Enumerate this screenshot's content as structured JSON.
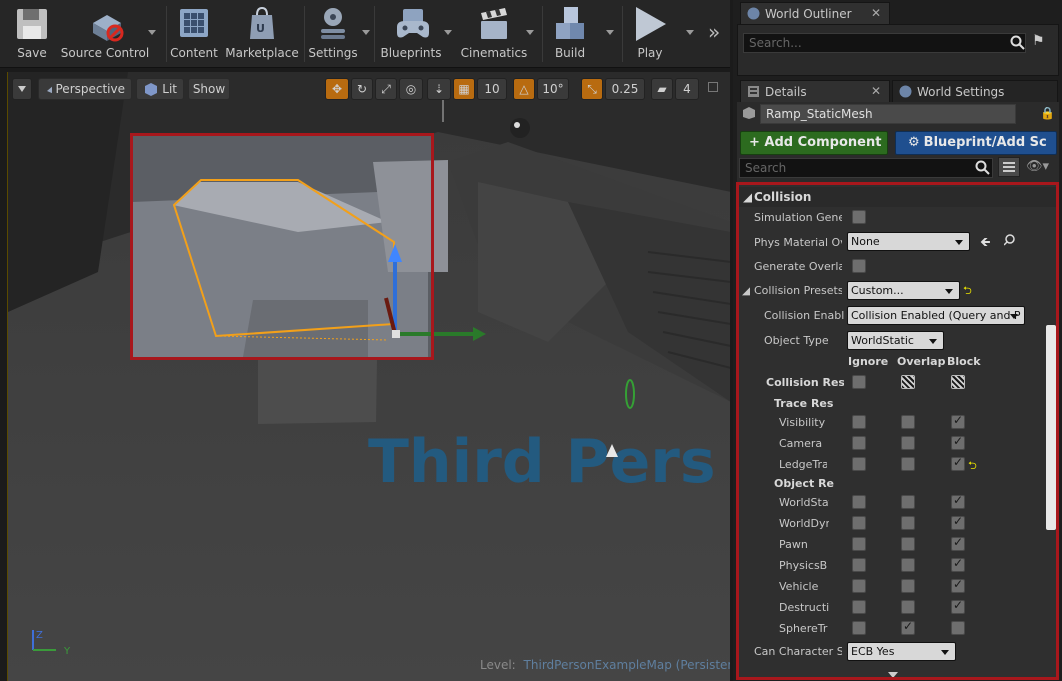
{
  "toolbar": {
    "buttons": [
      {
        "label": "Save",
        "icon": "floppy-disk-icon"
      },
      {
        "label": "Source Control",
        "icon": "source-control-icon"
      },
      {
        "label": "Content",
        "icon": "content-grid-icon"
      },
      {
        "label": "Marketplace",
        "icon": "marketplace-bag-icon"
      },
      {
        "label": "Settings",
        "icon": "gear-stack-icon"
      },
      {
        "label": "Blueprints",
        "icon": "gamepad-icon"
      },
      {
        "label": "Cinematics",
        "icon": "clapperboard-icon"
      },
      {
        "label": "Build",
        "icon": "build-blocks-icon"
      },
      {
        "label": "Play",
        "icon": "play-triangle-icon"
      }
    ],
    "overflow": "»"
  },
  "viewport": {
    "perspective_label": "Perspective",
    "lit_label": "Lit",
    "show_label": "Show",
    "grid_snap": "10",
    "rotation_snap": "10°",
    "scale_snap": "0.25",
    "camera_speed": "4",
    "level_prefix": "Level:",
    "level_name": "ThirdPersonExampleMap (Persistent)",
    "floor_text": "Third Pers",
    "axis_z": "Z",
    "axis_y": "Y"
  },
  "outliner": {
    "tab_label": "World Outliner",
    "search_placeholder": "Search..."
  },
  "details": {
    "tab_label": "Details",
    "world_settings_label": "World Settings",
    "object_name": "Ramp_StaticMesh",
    "add_component_label": "+ Add Component",
    "blueprint_label": "Blueprint/Add Sc",
    "search_placeholder": "Search",
    "section_title": "Collision",
    "simulation_generates_label": "Simulation Genera",
    "phys_material_label": "Phys Material Ov",
    "phys_material_value": "None",
    "generate_overlap_label": "Generate Overlap",
    "collision_presets_label": "Collision Presets",
    "collision_presets_value": "Custom...",
    "collision_enabled_label": "Collision Enable",
    "collision_enabled_value": "Collision Enabled (Query and P",
    "object_type_label": "Object Type",
    "object_type_value": "WorldStatic",
    "col_ignore": "Ignore",
    "col_overlap": "Overlap",
    "col_block": "Block",
    "collision_responses_label": "Collision Respo",
    "trace_responses_label": "Trace Resp",
    "object_responses_label": "Object Resp",
    "trace_rows": [
      {
        "label": "Visibility",
        "ignore": false,
        "overlap": false,
        "block": true
      },
      {
        "label": "Camera",
        "ignore": false,
        "overlap": false,
        "block": true
      },
      {
        "label": "LedgeTra",
        "ignore": false,
        "overlap": false,
        "block": true,
        "reset": true
      }
    ],
    "object_rows": [
      {
        "label": "WorldStat",
        "ignore": false,
        "overlap": false,
        "block": true
      },
      {
        "label": "WorldDyn",
        "ignore": false,
        "overlap": false,
        "block": true
      },
      {
        "label": "Pawn",
        "ignore": false,
        "overlap": false,
        "block": true
      },
      {
        "label": "PhysicsB",
        "ignore": false,
        "overlap": false,
        "block": true
      },
      {
        "label": "Vehicle",
        "ignore": false,
        "overlap": false,
        "block": true
      },
      {
        "label": "Destructi",
        "ignore": false,
        "overlap": false,
        "block": true
      },
      {
        "label": "SphereTr",
        "ignore": false,
        "overlap": true,
        "block": false
      }
    ],
    "can_character_step_label": "Can Character Ste",
    "can_character_step_value": "ECB Yes"
  },
  "colors": {
    "highlight_red": "#a8171c",
    "selection_orange": "#f2a01a",
    "add_component_green": "#2c6b1f",
    "blueprint_blue": "#1f4f8f",
    "floor_text_blue": "#1e5f8a"
  }
}
